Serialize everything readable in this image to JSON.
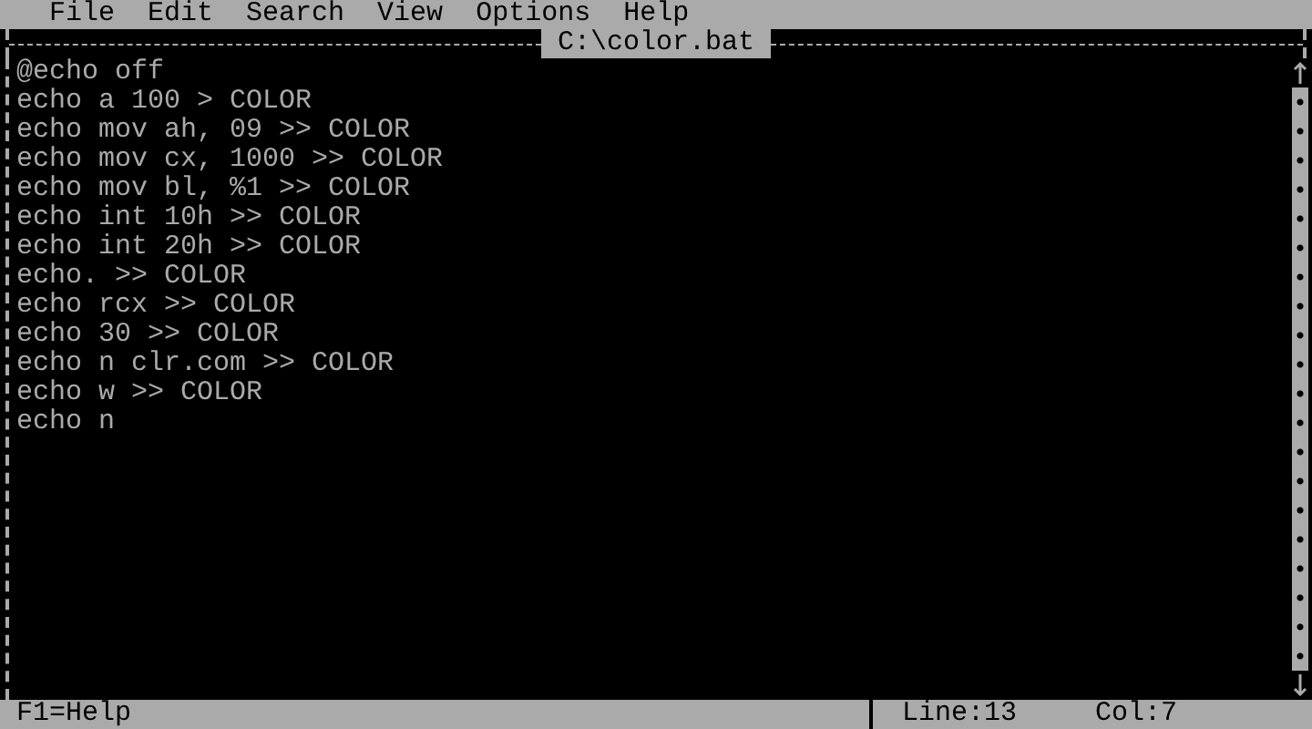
{
  "menu": [
    {
      "label": "File"
    },
    {
      "label": "Edit"
    },
    {
      "label": "Search"
    },
    {
      "label": "View"
    },
    {
      "label": "Options"
    },
    {
      "label": "Help"
    }
  ],
  "document": {
    "title": "C:\\color.bat",
    "lines": [
      "@echo off",
      "echo a 100 > COLOR",
      "echo mov ah, 09 >> COLOR",
      "echo mov cx, 1000 >> COLOR",
      "echo mov bl, %1 >> COLOR",
      "echo int 10h >> COLOR",
      "echo int 20h >> COLOR",
      "echo. >> COLOR",
      "echo rcx >> COLOR",
      "echo 30 >> COLOR",
      "echo n clr.com >> COLOR",
      "echo w >> COLOR",
      "echo n"
    ]
  },
  "status_bar": {
    "hint": "F1=Help",
    "line": "Line:13",
    "column": "Col:7"
  }
}
